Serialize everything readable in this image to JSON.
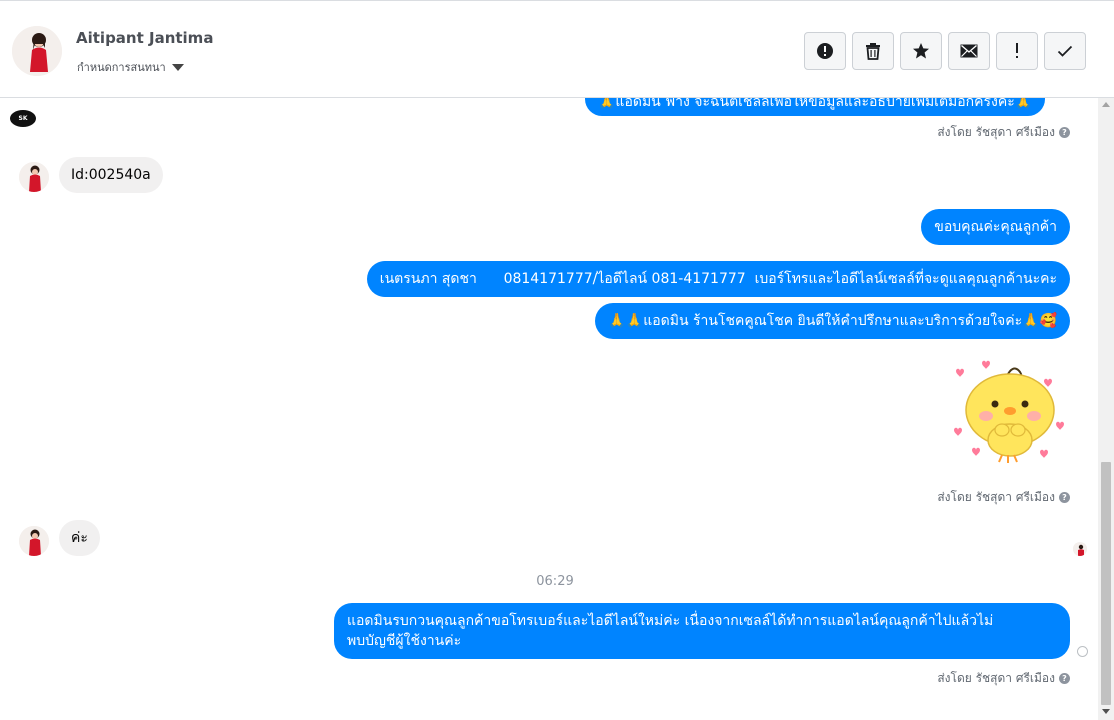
{
  "header": {
    "contact_name": "Aitipant Jantima",
    "assign_label": "กำหนดการสนทนา",
    "toolbar": [
      {
        "name": "mark-spam-button",
        "icon": "alert-circle-icon"
      },
      {
        "name": "delete-button",
        "icon": "trash-icon"
      },
      {
        "name": "star-button",
        "icon": "star-icon"
      },
      {
        "name": "mark-unread-button",
        "icon": "envelope-icon"
      },
      {
        "name": "follow-up-button",
        "icon": "exclamation-icon"
      },
      {
        "name": "mark-done-button",
        "icon": "checkmark-icon"
      }
    ]
  },
  "thread": {
    "top_partial_message": "🙏แอดมิน ฟาง จะฉนตเชลล์เพอให้ข้อมูลและอธิบายเพิ่มเติมอีกครั้งคะ🙏",
    "sent_by_1": "ส่งโดย รัชสุดา ศรีเมือง",
    "incoming_1": "Id:002540a",
    "outgoing_1": "ขอบคุณค่ะคุณลูกค้า",
    "outgoing_2": "เนตรนภา สุดชา      0814171777/ไอดีไลน์ 081-4171777  เบอร์โทรและไอดีไลน์เซลล์ที่จะดูแลคุณลูกค้านะคะ",
    "outgoing_3": "🙏🙏แอดมิน ร้านโชคคูณโชค ยินดีให้คำปรึกษาและบริการด้วยใจค่ะ🙏🥰",
    "sent_by_2": "ส่งโดย รัชสุดา ศรีเมือง",
    "incoming_2": "ค่ะ",
    "time_divider": "06:29",
    "outgoing_4_line1": "แอดมินรบกวนคุณลูกค้าขอโทรเบอร์และไอดีไลน์ใหม่ค่ะ เนื่องจากเซลล์ได้ทำการแอดไลน์คุณลูกค้าไปแล้วไม่",
    "outgoing_4_line2": "พบบัญชีผู้ใช้งานค่ะ",
    "sent_by_3": "ส่งโดย รัชสุดา ศรีเมือง",
    "help_glyph": "?",
    "logo_text": "SK"
  },
  "colors": {
    "outgoing_bubble": "#0084ff",
    "incoming_bubble": "#f1f0f0",
    "sticker_body": "#ffe55c"
  }
}
